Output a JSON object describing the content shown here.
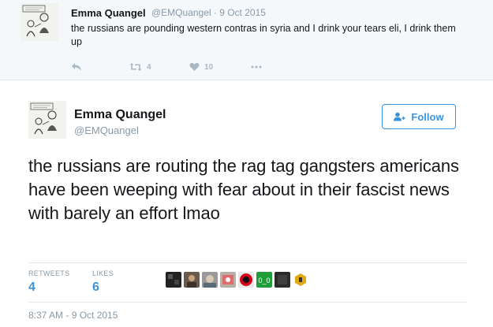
{
  "previous_tweet": {
    "name": "Emma Quangel",
    "handle_date": "@EMQuangel · 9 Oct 2015",
    "text": "the russians are pounding western contras in syria and I drink your tears eli, I drink them up",
    "retweet_count": "4",
    "like_count": "10"
  },
  "tweet": {
    "name": "Emma Quangel",
    "handle": "@EMQuangel",
    "follow_label": "Follow",
    "text": "the russians are routing the rag tag gangsters americans have been weeping with fear about in their fascist news with barely an effort lmao",
    "retweets_label": "RETWEETS",
    "retweets_value": "4",
    "likes_label": "LIKES",
    "likes_value": "6",
    "timestamp": "8:37 AM - 9 Oct 2015"
  },
  "colors": {
    "accent": "#3b94d9",
    "muted": "#8899a6",
    "text": "#14171a"
  }
}
